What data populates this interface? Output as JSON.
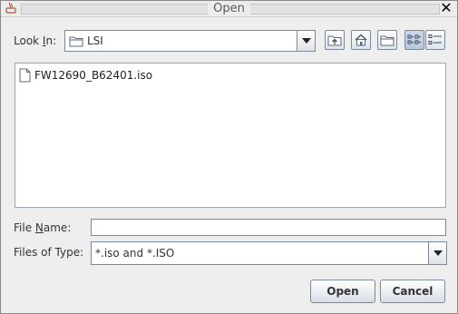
{
  "window": {
    "title": "Open"
  },
  "look_in": {
    "label_before": "Look ",
    "label_mnemonic": "I",
    "label_after": "n:",
    "value": "LSI"
  },
  "toolbar": {
    "icons": [
      "up-one-level-icon",
      "home-icon",
      "new-folder-icon",
      "list-view-icon",
      "details-view-icon"
    ]
  },
  "files": [
    {
      "name": "FW12690_B62401.iso",
      "icon": "file-icon"
    }
  ],
  "file_name": {
    "label_before": "File ",
    "label_mnemonic": "N",
    "label_after": "ame:",
    "value": ""
  },
  "file_type": {
    "label": "Files of Type:",
    "value": "*.iso and *.ISO"
  },
  "buttons": {
    "open": "Open",
    "cancel": "Cancel"
  },
  "colors": {
    "accent_border": "#7a8a99",
    "background": "#eeeeee"
  }
}
